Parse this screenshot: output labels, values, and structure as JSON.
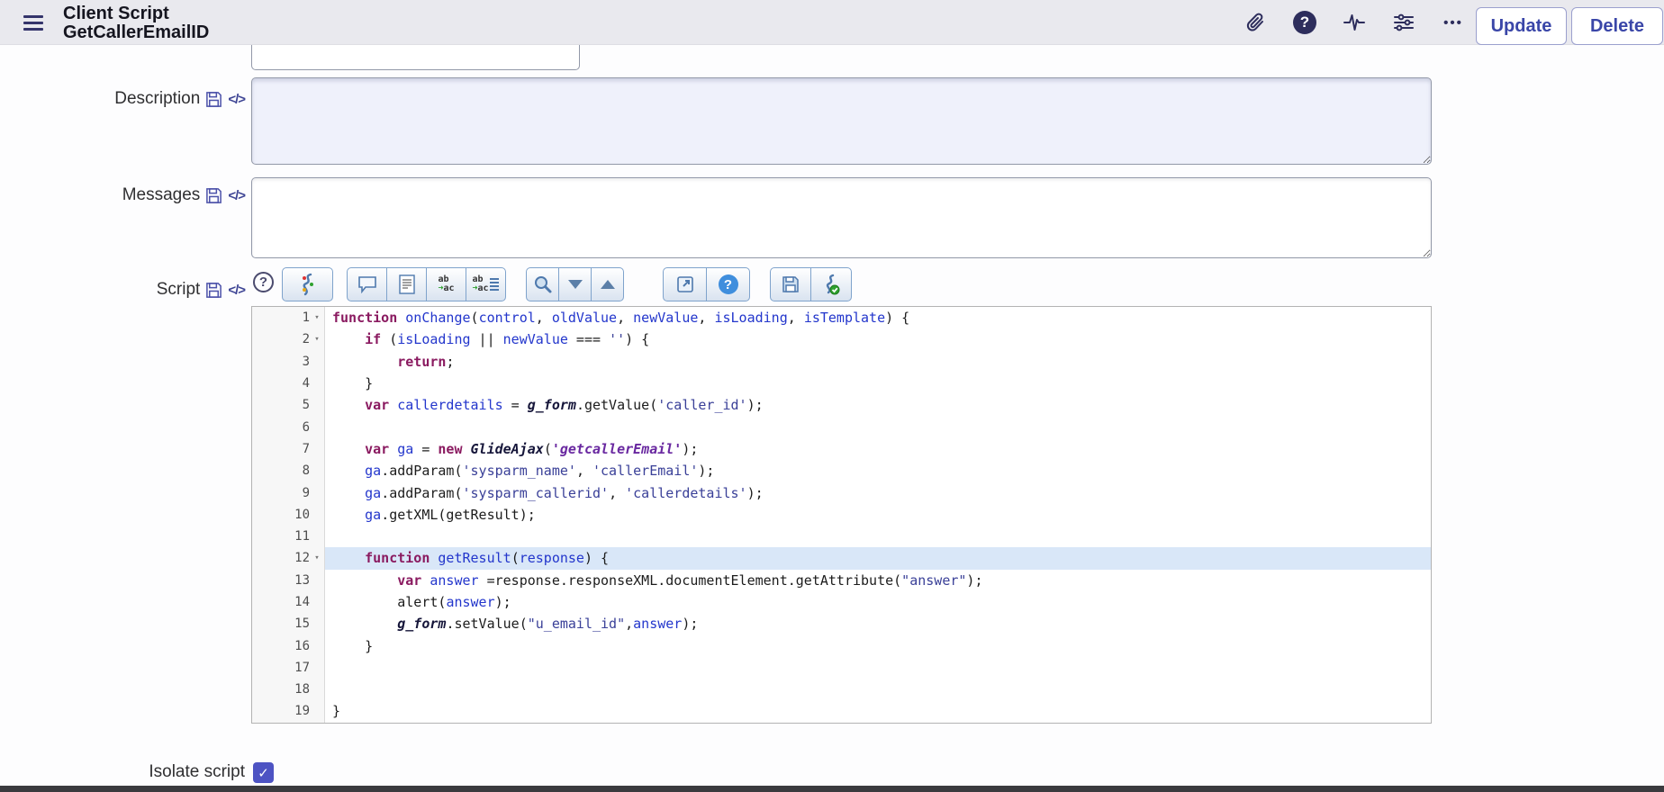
{
  "header": {
    "title_line1": "Client Script",
    "title_line2": "GetCallerEmailID",
    "update_label": "Update",
    "delete_label": "Delete",
    "more_label": "•••",
    "help_glyph": "?",
    "icons": [
      "menu-icon",
      "attachment-icon",
      "help-icon",
      "activity-icon",
      "sliders-icon",
      "more-icon"
    ]
  },
  "fields": {
    "description_label": "Description",
    "description_value": "",
    "messages_label": "Messages",
    "messages_value": "",
    "script_label": "Script",
    "isolate_label": "Isolate script",
    "isolate_checked": true,
    "check_glyph": "✓",
    "code_icon_glyph": "</>"
  },
  "toolbar": {
    "help_glyph": "?",
    "blue_help_glyph": "?",
    "replace_top": "ab",
    "replace_bottom": "ac",
    "icons": [
      "editor-help-icon",
      "format-code-icon",
      "comment-icon",
      "document-icon",
      "replace-icon",
      "replace-all-icon",
      "search-icon",
      "chevron-down-icon",
      "chevron-up-icon",
      "open-window-icon",
      "help-circle-icon",
      "save-icon",
      "validate-script-icon"
    ]
  },
  "editor": {
    "active_line": 12,
    "fold_glyph": "▾",
    "lines": [
      {
        "num": 1,
        "fold": true,
        "seg": [
          [
            "k",
            "function"
          ],
          [
            "p",
            " "
          ],
          [
            "v",
            "onChange"
          ],
          [
            "p",
            "("
          ],
          [
            "v",
            "control"
          ],
          [
            "p",
            ", "
          ],
          [
            "v",
            "oldValue"
          ],
          [
            "p",
            ", "
          ],
          [
            "v",
            "newValue"
          ],
          [
            "p",
            ", "
          ],
          [
            "v",
            "isLoading"
          ],
          [
            "p",
            ", "
          ],
          [
            "v",
            "isTemplate"
          ],
          [
            "p",
            ") {"
          ]
        ]
      },
      {
        "num": 2,
        "fold": true,
        "seg": [
          [
            "p",
            "    "
          ],
          [
            "k",
            "if"
          ],
          [
            "p",
            " ("
          ],
          [
            "v",
            "isLoading"
          ],
          [
            "p",
            " || "
          ],
          [
            "v",
            "newValue"
          ],
          [
            "p",
            " === "
          ],
          [
            "s",
            "''"
          ],
          [
            "p",
            ") {"
          ]
        ]
      },
      {
        "num": 3,
        "fold": false,
        "seg": [
          [
            "p",
            "        "
          ],
          [
            "k",
            "return"
          ],
          [
            "p",
            ";"
          ]
        ]
      },
      {
        "num": 4,
        "fold": false,
        "seg": [
          [
            "p",
            "    }"
          ]
        ]
      },
      {
        "num": 5,
        "fold": false,
        "seg": [
          [
            "p",
            "    "
          ],
          [
            "k",
            "var"
          ],
          [
            "p",
            " "
          ],
          [
            "v",
            "callerdetails"
          ],
          [
            "p",
            " = "
          ],
          [
            "g",
            "g_form"
          ],
          [
            "p",
            ".getValue("
          ],
          [
            "s",
            "'caller_id'"
          ],
          [
            "p",
            ");"
          ]
        ]
      },
      {
        "num": 6,
        "fold": false,
        "seg": []
      },
      {
        "num": 7,
        "fold": false,
        "seg": [
          [
            "p",
            "    "
          ],
          [
            "k",
            "var"
          ],
          [
            "p",
            " "
          ],
          [
            "v",
            "ga"
          ],
          [
            "p",
            " = "
          ],
          [
            "k",
            "new"
          ],
          [
            "p",
            " "
          ],
          [
            "g",
            "GlideAjax"
          ],
          [
            "p",
            "("
          ],
          [
            "sp",
            "'getcallerEmail'"
          ],
          [
            "p",
            ");"
          ]
        ]
      },
      {
        "num": 8,
        "fold": false,
        "seg": [
          [
            "p",
            "    "
          ],
          [
            "v",
            "ga"
          ],
          [
            "p",
            ".addParam("
          ],
          [
            "s",
            "'sysparm_name'"
          ],
          [
            "p",
            ", "
          ],
          [
            "s",
            "'callerEmail'"
          ],
          [
            "p",
            ");"
          ]
        ]
      },
      {
        "num": 9,
        "fold": false,
        "seg": [
          [
            "p",
            "    "
          ],
          [
            "v",
            "ga"
          ],
          [
            "p",
            ".addParam("
          ],
          [
            "s",
            "'sysparm_callerid'"
          ],
          [
            "p",
            ", "
          ],
          [
            "s",
            "'callerdetails'"
          ],
          [
            "p",
            ");"
          ]
        ]
      },
      {
        "num": 10,
        "fold": false,
        "seg": [
          [
            "p",
            "    "
          ],
          [
            "v",
            "ga"
          ],
          [
            "p",
            ".getXML(getResult);"
          ]
        ]
      },
      {
        "num": 11,
        "fold": false,
        "seg": []
      },
      {
        "num": 12,
        "fold": true,
        "seg": [
          [
            "p",
            "    "
          ],
          [
            "k",
            "function"
          ],
          [
            "p",
            " "
          ],
          [
            "v",
            "getResult"
          ],
          [
            "p",
            "("
          ],
          [
            "v",
            "response"
          ],
          [
            "p",
            ") {"
          ]
        ]
      },
      {
        "num": 13,
        "fold": false,
        "seg": [
          [
            "p",
            "        "
          ],
          [
            "k",
            "var"
          ],
          [
            "p",
            " "
          ],
          [
            "v",
            "answer"
          ],
          [
            "p",
            " =response.responseXML.documentElement.getAttribute("
          ],
          [
            "s",
            "\"answer\""
          ],
          [
            "p",
            ");"
          ]
        ]
      },
      {
        "num": 14,
        "fold": false,
        "seg": [
          [
            "p",
            "        alert("
          ],
          [
            "v",
            "answer"
          ],
          [
            "p",
            ");"
          ]
        ]
      },
      {
        "num": 15,
        "fold": false,
        "seg": [
          [
            "p",
            "        "
          ],
          [
            "g",
            "g_form"
          ],
          [
            "p",
            ".setValue("
          ],
          [
            "s",
            "\"u_email_id\""
          ],
          [
            "p",
            ","
          ],
          [
            "v",
            "answer"
          ],
          [
            "p",
            ");"
          ]
        ]
      },
      {
        "num": 16,
        "fold": false,
        "seg": [
          [
            "p",
            "    }"
          ]
        ]
      },
      {
        "num": 17,
        "fold": false,
        "seg": []
      },
      {
        "num": 18,
        "fold": false,
        "seg": []
      },
      {
        "num": 19,
        "fold": false,
        "seg": [
          [
            "p",
            "}"
          ]
        ]
      }
    ]
  },
  "colors": {
    "header_bg": "#e9e9ee",
    "accent_indigo": "#2d2d5c",
    "button_text": "#3a46a8",
    "checkbox": "#4d53c3",
    "active_line": "#d9e7f8",
    "keyword": "#8a1a60",
    "variable": "#2336cc",
    "string": "#3a4098",
    "special_string": "#6928a0",
    "toolbar_icon_blue": "#4e79ad"
  }
}
